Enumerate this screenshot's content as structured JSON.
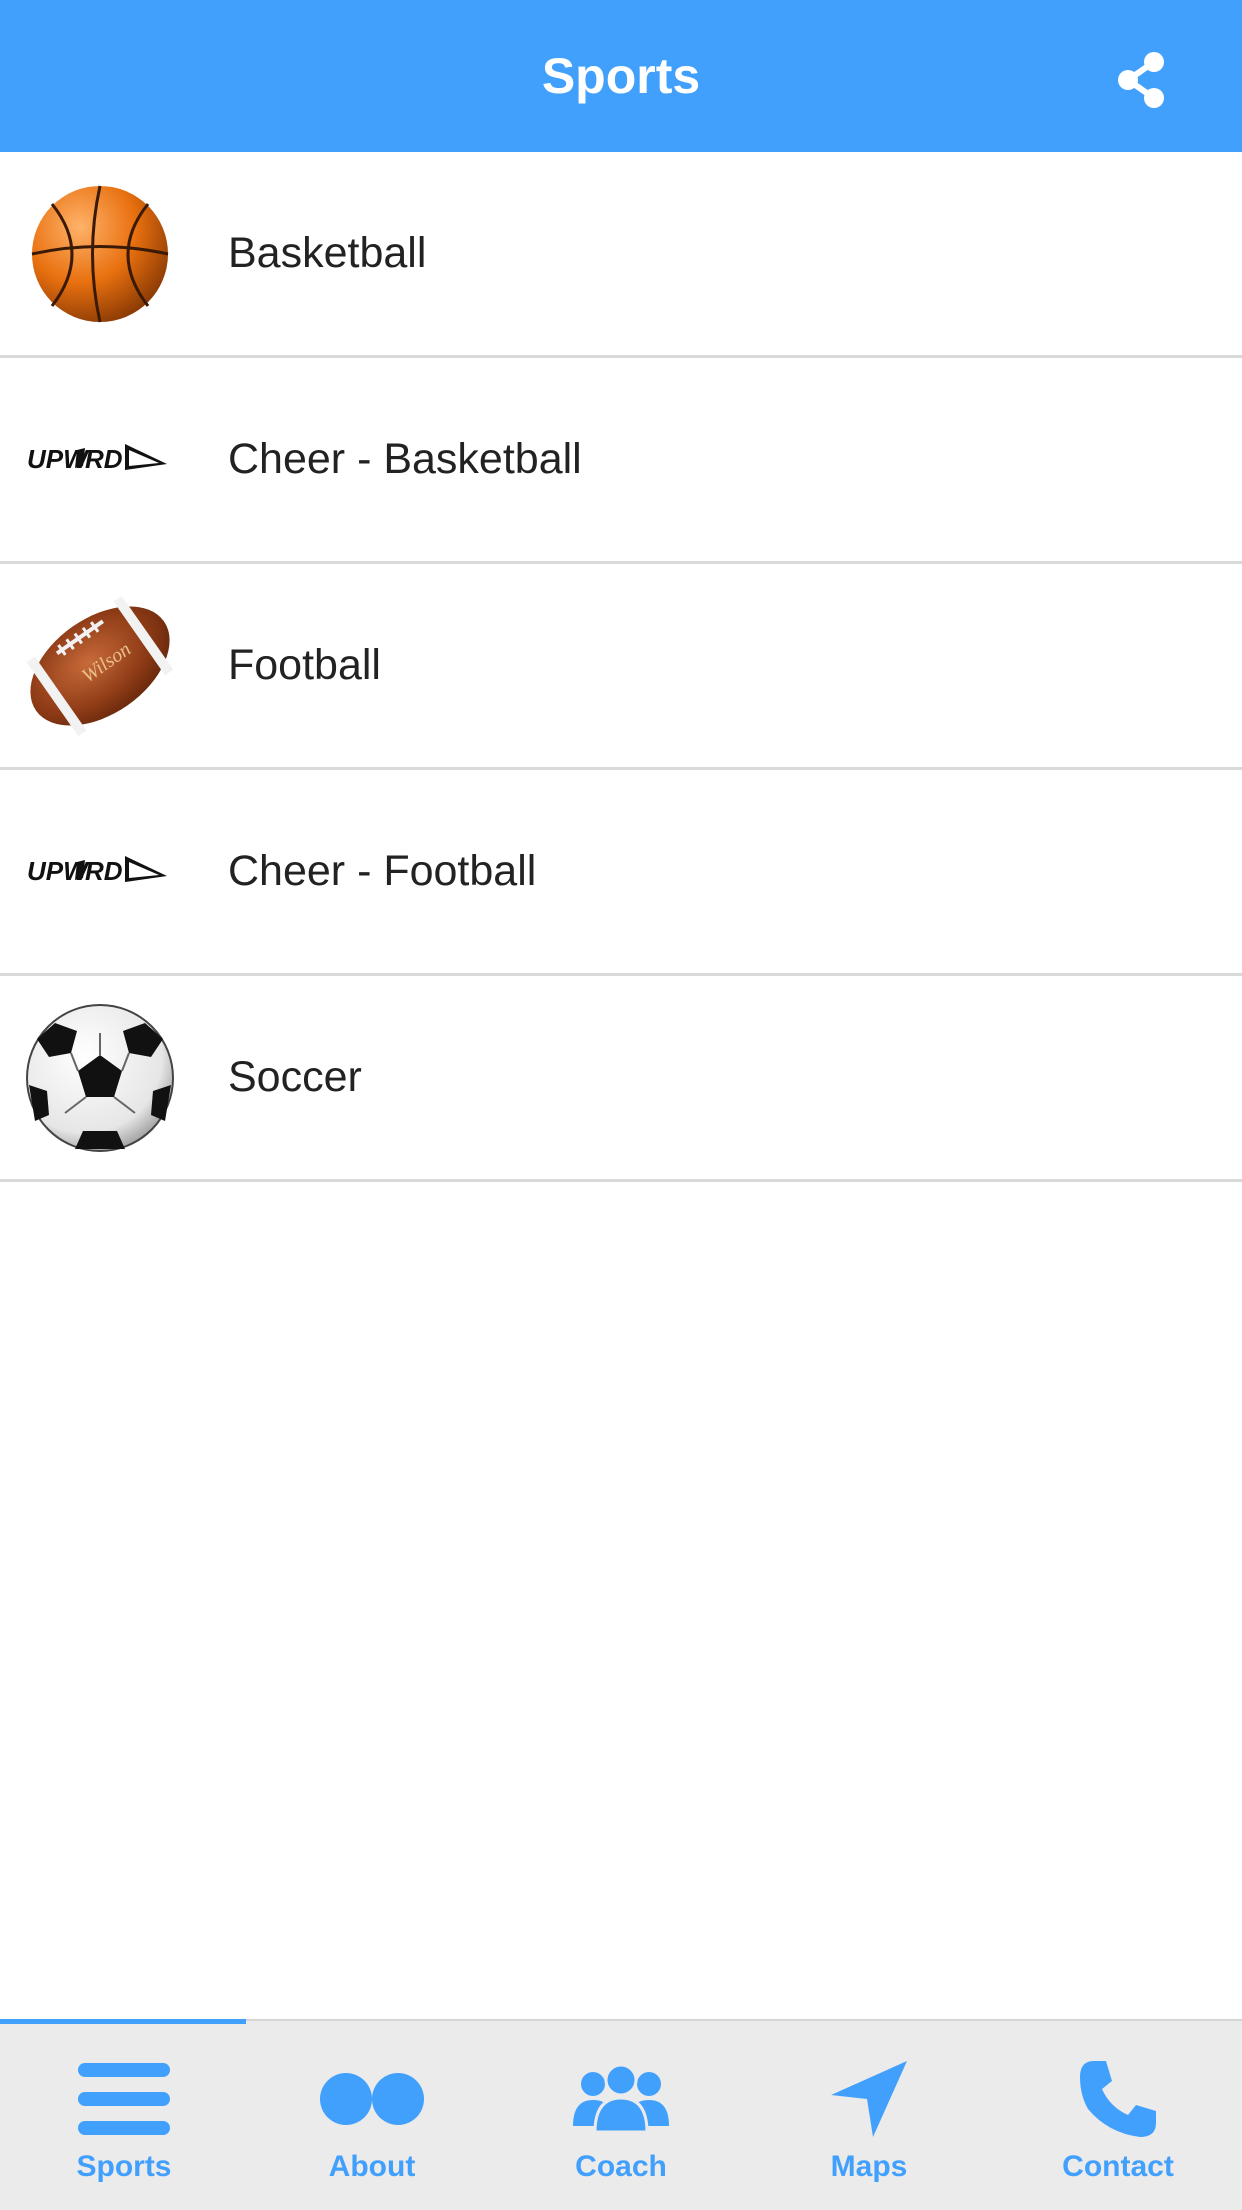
{
  "header": {
    "title": "Sports",
    "share_icon": "share-icon"
  },
  "colors": {
    "accent": "#42a0fd",
    "tabbar_bg": "#ebebeb",
    "divider": "#d9d9d9"
  },
  "sports": [
    {
      "label": "Basketball",
      "icon": "basketball-icon"
    },
    {
      "label": "Cheer - Basketball",
      "icon": "upward-logo"
    },
    {
      "label": "Football",
      "icon": "football-icon"
    },
    {
      "label": "Cheer - Football",
      "icon": "upward-logo"
    },
    {
      "label": "Soccer",
      "icon": "soccer-ball-icon"
    }
  ],
  "tabs": [
    {
      "label": "Sports",
      "icon": "menu-icon",
      "active": true
    },
    {
      "label": "About",
      "icon": "about-icon",
      "active": false
    },
    {
      "label": "Coach",
      "icon": "group-icon",
      "active": false
    },
    {
      "label": "Maps",
      "icon": "navigation-arrow-icon",
      "active": false
    },
    {
      "label": "Contact",
      "icon": "phone-icon",
      "active": false
    }
  ]
}
